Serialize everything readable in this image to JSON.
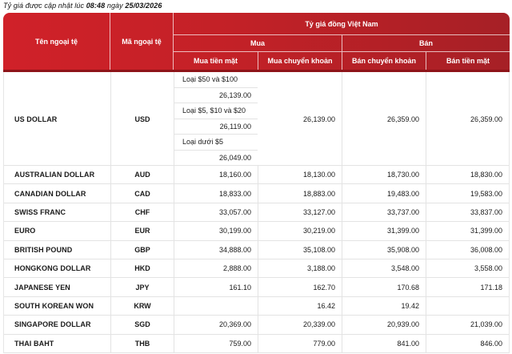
{
  "title": {
    "prefix": "Tỷ giá được cập nhật lúc",
    "time": "08:48",
    "middle": "ngày",
    "date": "25/03/2026"
  },
  "table": {
    "headers": {
      "currency_name": "Tên ngoại tệ",
      "currency_code": "Mã ngoại tệ",
      "vnd_title": "Tỷ giá đồng Việt Nam",
      "buy": "Mua",
      "sell": "Bán",
      "buy_cash": "Mua tiền mặt",
      "buy_transfer": "Mua chuyển khoản",
      "sell_transfer": "Bán chuyển khoản",
      "sell_cash": "Bán tiền mặt"
    },
    "usd": {
      "name": "US DOLLAR",
      "code": "USD",
      "tiers": [
        {
          "label": "Loại $50 và $100",
          "value": "26,139.00"
        },
        {
          "label": "Loại $5, $10 và $20",
          "value": "26,119.00"
        },
        {
          "label": "Loại dưới $5",
          "value": "26,049.00"
        }
      ],
      "buy_transfer": "26,139.00",
      "sell_transfer": "26,359.00",
      "sell_cash": "26,359.00"
    },
    "rows": [
      {
        "name": "AUSTRALIAN DOLLAR",
        "code": "AUD",
        "buy_cash": "18,160.00",
        "buy_transfer": "18,130.00",
        "sell_transfer": "18,730.00",
        "sell_cash": "18,830.00"
      },
      {
        "name": "CANADIAN DOLLAR",
        "code": "CAD",
        "buy_cash": "18,833.00",
        "buy_transfer": "18,883.00",
        "sell_transfer": "19,483.00",
        "sell_cash": "19,583.00"
      },
      {
        "name": "SWISS FRANC",
        "code": "CHF",
        "buy_cash": "33,057.00",
        "buy_transfer": "33,127.00",
        "sell_transfer": "33,737.00",
        "sell_cash": "33,837.00"
      },
      {
        "name": "EURO",
        "code": "EUR",
        "buy_cash": "30,199.00",
        "buy_transfer": "30,219.00",
        "sell_transfer": "31,399.00",
        "sell_cash": "31,399.00"
      },
      {
        "name": "BRITISH POUND",
        "code": "GBP",
        "buy_cash": "34,888.00",
        "buy_transfer": "35,108.00",
        "sell_transfer": "35,908.00",
        "sell_cash": "36,008.00"
      },
      {
        "name": "HONGKONG DOLLAR",
        "code": "HKD",
        "buy_cash": "2,888.00",
        "buy_transfer": "3,188.00",
        "sell_transfer": "3,548.00",
        "sell_cash": "3,558.00"
      },
      {
        "name": "JAPANESE YEN",
        "code": "JPY",
        "buy_cash": "161.10",
        "buy_transfer": "162.70",
        "sell_transfer": "170.68",
        "sell_cash": "171.18"
      },
      {
        "name": "SOUTH KOREAN WON",
        "code": "KRW",
        "buy_cash": "",
        "buy_transfer": "16.42",
        "sell_transfer": "19.42",
        "sell_cash": ""
      },
      {
        "name": "SINGAPORE DOLLAR",
        "code": "SGD",
        "buy_cash": "20,369.00",
        "buy_transfer": "20,339.00",
        "sell_transfer": "20,939.00",
        "sell_cash": "21,039.00"
      },
      {
        "name": "THAI BAHT",
        "code": "THB",
        "buy_cash": "759.00",
        "buy_transfer": "779.00",
        "sell_transfer": "841.00",
        "sell_cash": "846.00"
      }
    ]
  },
  "colors": {
    "header_red_left": "#D02129",
    "header_red_right": "#A62026",
    "header_bottom_border": "#8E1419",
    "header_divider": "rgba(255,255,255,0.7)",
    "body_border": "#E3E3E3",
    "text": "#1A1A1A"
  }
}
